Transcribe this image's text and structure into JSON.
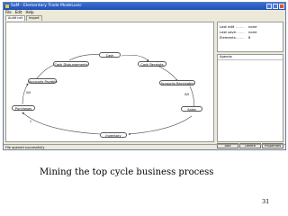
{
  "window": {
    "title": "SaM - Elementary Trade ModeLusic",
    "menu": [
      "File",
      "Edit",
      "Help"
    ],
    "tabs": [
      "Audit net",
      "Import"
    ]
  },
  "diagram": {
    "nodes": {
      "cash": "Cash",
      "cash_disbursements": "Cash Disbursements",
      "cash_receipts": "Cash Receipts",
      "accounts_payable": "Accounts Payable",
      "accounts_receivable": "Accounts Receivable",
      "purchases": "Purchases",
      "sales": "Sales",
      "inventory": "Inventory"
    },
    "edge_labels": {
      "ap": "0/0",
      "ar": "0/0",
      "purch": "1"
    }
  },
  "properties": {
    "rows": [
      {
        "key": "Last edit",
        "dots": "........",
        "value": "none"
      },
      {
        "key": "Last save",
        "dots": "........",
        "value": "none"
      },
      {
        "key": "Elements",
        "dots": "........",
        "value": "8"
      }
    ]
  },
  "agenda": {
    "title": "Agenda"
  },
  "buttons": {
    "add": "Add",
    "delete": "Delete",
    "properties": "Properties"
  },
  "status": "File opened successfully",
  "slide": {
    "caption": "Mining the top cycle business process",
    "page": "31"
  }
}
